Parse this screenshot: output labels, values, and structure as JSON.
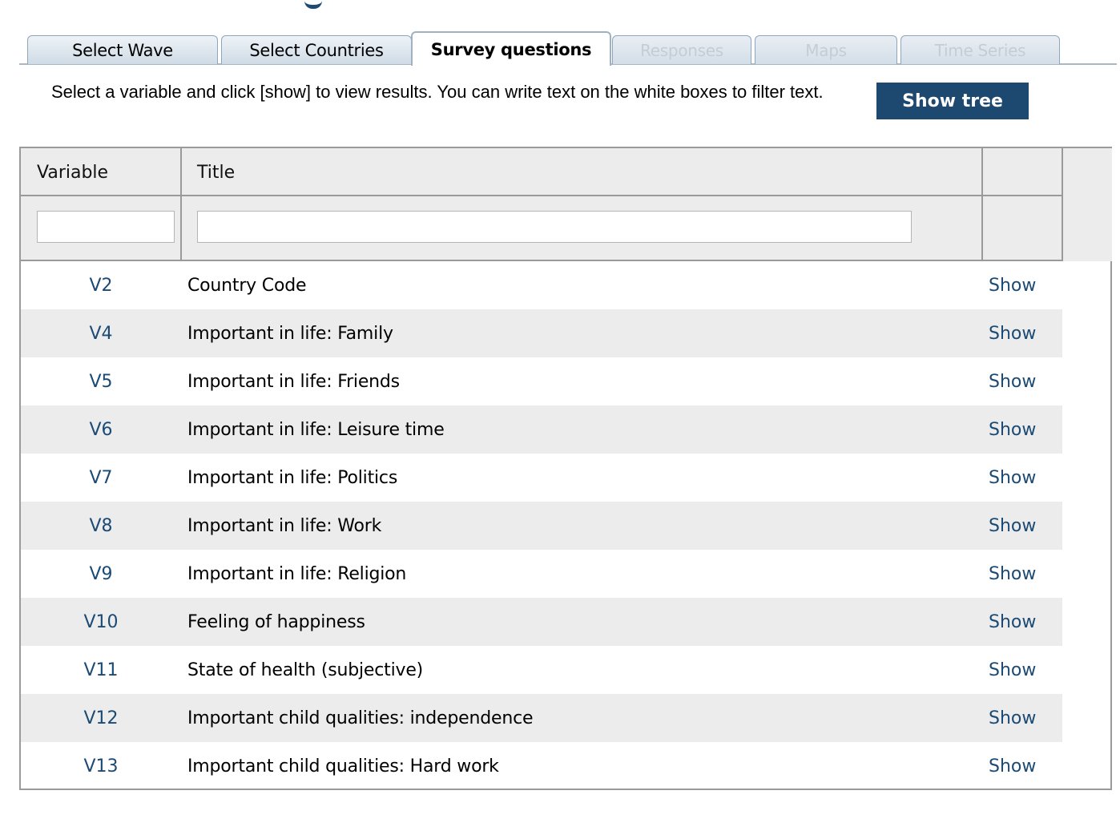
{
  "tabs": [
    {
      "label": "Select Wave",
      "state": "normal"
    },
    {
      "label": "Select Countries",
      "state": "normal"
    },
    {
      "label": "Survey questions",
      "state": "active"
    },
    {
      "label": "Responses",
      "state": "disabled"
    },
    {
      "label": "Maps",
      "state": "disabled"
    },
    {
      "label": "Time Series",
      "state": "disabled"
    }
  ],
  "instruction": "Select a variable and click [show] to view results. You can write text on the white boxes to filter text.",
  "show_tree_label": "Show tree",
  "table": {
    "headers": {
      "variable": "Variable",
      "title": "Title"
    },
    "filters": {
      "variable": "",
      "title": ""
    },
    "show_label": "Show",
    "rows": [
      {
        "variable": "V2",
        "title": "Country Code"
      },
      {
        "variable": "V4",
        "title": "Important in life: Family"
      },
      {
        "variable": "V5",
        "title": "Important in life: Friends"
      },
      {
        "variable": "V6",
        "title": "Important in life: Leisure time"
      },
      {
        "variable": "V7",
        "title": "Important in life: Politics"
      },
      {
        "variable": "V8",
        "title": "Important in life: Work"
      },
      {
        "variable": "V9",
        "title": "Important in life: Religion"
      },
      {
        "variable": "V10",
        "title": "Feeling of happiness"
      },
      {
        "variable": "V11",
        "title": "State of health (subjective)"
      },
      {
        "variable": "V12",
        "title": "Important child qualities: independence"
      },
      {
        "variable": "V13",
        "title": "Important child qualities: Hard work"
      }
    ]
  },
  "colors": {
    "link": "#1b4a75",
    "button": "#1d4870",
    "alt_row": "#ececec"
  }
}
